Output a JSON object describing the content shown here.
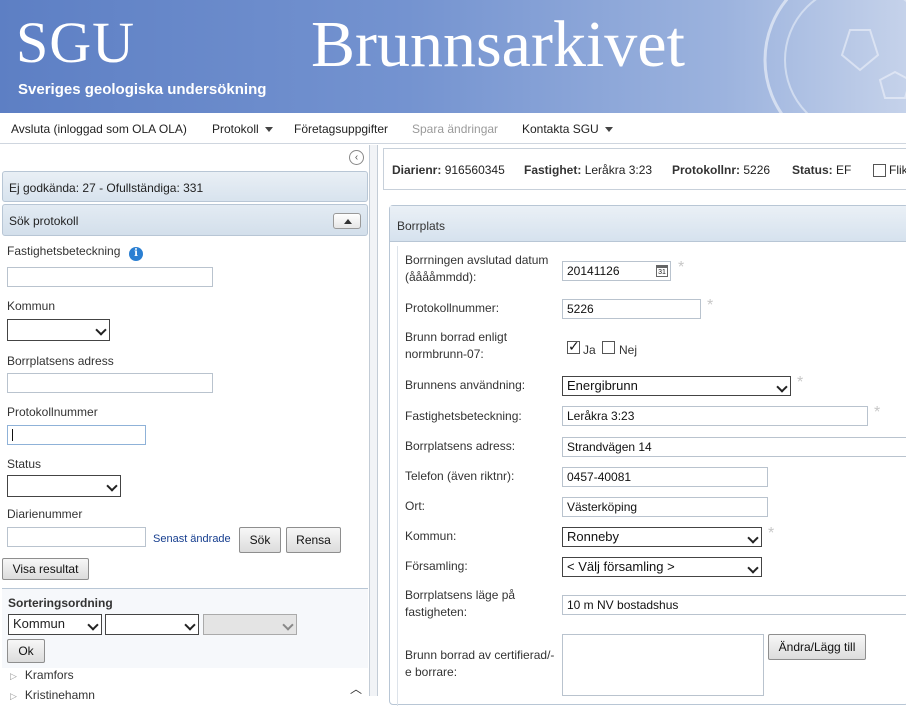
{
  "header": {
    "logo": "SGU",
    "logo_subtitle": "Sveriges geologiska undersökning",
    "app_title": "Brunnsarkivet"
  },
  "menu": {
    "logout": "Avsluta (inloggad som OLA OLA)",
    "protokoll": "Protokoll",
    "foretag": "Företagsuppgifter",
    "spara": "Spara ändringar",
    "kontakta": "Kontakta SGU"
  },
  "left": {
    "status_summary": "Ej godkända: 27 - Ofullständiga: 331",
    "search_title": "Sök protokoll",
    "fields": {
      "fastighet_label": "Fastighetsbeteckning",
      "kommun_label": "Kommun",
      "adress_label": "Borrplatsens adress",
      "protokollnr_label": "Protokollnummer",
      "status_label": "Status",
      "diarienr_label": "Diarienummer"
    },
    "senast_andrade": "Senast ändrade",
    "btn_sok": "Sök",
    "btn_rensa": "Rensa",
    "btn_visa": "Visa resultat",
    "sort_title": "Sorteringsordning",
    "sort_first": "Kommun",
    "btn_ok": "Ok",
    "tree": [
      "Kramfors",
      "Kristinehamn"
    ]
  },
  "right": {
    "info": {
      "diarienr_label": "Diarienr:",
      "diarienr": "916560345",
      "fastighet_label": "Fastighet:",
      "fastighet": "Leråkra 3:23",
      "protokollnr_label": "Protokollnr:",
      "protokollnr": "5226",
      "status_label": "Status:",
      "status": "EF",
      "flik": "Flik"
    },
    "section_title": "Borrplats",
    "form": {
      "datum_label": "Borrningen avslutad datum (ååååmmdd):",
      "datum": "20141126",
      "protokollnr_label": "Protokollnummer:",
      "protokollnr": "5226",
      "normbrunn_label": "Brunn borrad enligt normbrunn-07:",
      "ja": "Ja",
      "nej": "Nej",
      "anvandning_label": "Brunnens användning:",
      "anvandning": "Energibrunn",
      "fastighet_label": "Fastighetsbeteckning:",
      "fastighet": "Leråkra 3:23",
      "adress_label": "Borrplatsens adress:",
      "adress": "Strandvägen 14",
      "telefon_label": "Telefon (även riktnr):",
      "telefon": "0457-40081",
      "ort_label": "Ort:",
      "ort": "Västerköping",
      "kommun_label": "Kommun:",
      "kommun": "Ronneby",
      "forsamling_label": "Församling:",
      "forsamling": "< Välj församling >",
      "lage_label": "Borrplatsens läge på fastigheten:",
      "lage": "10 m NV bostadshus",
      "certifierad_label": "Brunn borrad av certifierad/-e borrare:",
      "btn_andra": "Ändra/Lägg till"
    }
  },
  "colors": {
    "header_blue": "#6a8ccb",
    "panel_head": "#dbe5ef"
  }
}
